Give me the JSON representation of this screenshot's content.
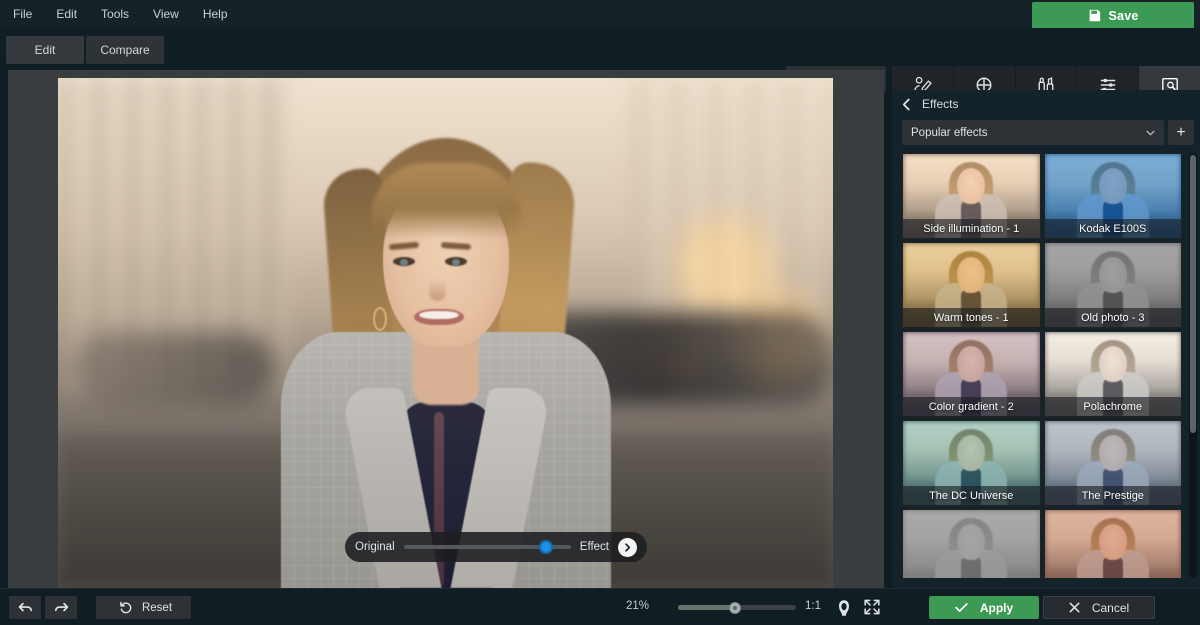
{
  "app": {
    "menu": [
      {
        "label": "File"
      },
      {
        "label": "Edit"
      },
      {
        "label": "Tools"
      },
      {
        "label": "View"
      },
      {
        "label": "Help"
      }
    ],
    "save_label": "Save",
    "save_icon": "floppy-disk-icon",
    "accent_green": "#3c9a55",
    "panel_bg": "#14222a",
    "canvas_bg": "#3a3d40"
  },
  "toolbar": {
    "mode_tabs": [
      {
        "label": "Edit",
        "active": true
      },
      {
        "label": "Compare",
        "active": false
      }
    ],
    "original_toggle": {
      "label": "Original",
      "icon": "eye-icon"
    }
  },
  "right_tabs": [
    {
      "label": "RETOUCH",
      "icon": "retouch-icon",
      "active": false
    },
    {
      "label": "SCULPT",
      "icon": "sculpt-icon",
      "active": false
    },
    {
      "label": "MAKEUP",
      "icon": "makeup-icon",
      "active": false
    },
    {
      "label": "COMMON",
      "icon": "sliders-icon",
      "active": false
    },
    {
      "label": "EFFECTS",
      "icon": "effects-icon",
      "active": true
    }
  ],
  "panel": {
    "back_icon": "chevron-left-icon",
    "title": "Effects",
    "preset": {
      "value": "Popular effects",
      "chevron": "chevron-down-icon"
    },
    "add_label": "+",
    "effects": [
      {
        "label": "Side illumination - 1",
        "tint": "rgba(255,215,180,0.30)"
      },
      {
        "label": "Kodak E100S",
        "tint": "rgba(35,120,200,0.52)"
      },
      {
        "label": "Warm tones - 1",
        "tint": "rgba(230,170,60,0.34)"
      },
      {
        "label": "Old photo - 3",
        "tint": "rgba(120,120,120,0.62)"
      },
      {
        "label": "Color gradient - 2",
        "tint": "rgba(150,120,170,0.30)"
      },
      {
        "label": "Polachrome",
        "tint": "rgba(215,205,190,0.28)"
      },
      {
        "label": "The DC Universe",
        "tint": "rgba(60,175,180,0.34)"
      },
      {
        "label": "The Prestige",
        "tint": "rgba(110,150,200,0.40)"
      },
      {
        "label": "",
        "tint": "rgba(140,140,140,0.72)"
      },
      {
        "label": "",
        "tint": "rgba(200,120,95,0.42)"
      }
    ]
  },
  "compare_slider": {
    "left_label": "Original",
    "right_label": "Effect",
    "value_percent": 85,
    "next_icon": "chevron-right-icon"
  },
  "bottombar": {
    "undo_icon": "undo-icon",
    "redo_icon": "redo-icon",
    "reset_icon": "reset-icon",
    "reset_label": "Reset",
    "zoom_percent": "21%",
    "zoom_slider_value": 48,
    "ratio_label": "1:1",
    "face_icon": "face-detect-icon",
    "fit_icon": "fit-to-screen-icon",
    "apply_label": "Apply",
    "apply_icon": "check-icon",
    "cancel_label": "Cancel",
    "cancel_icon": "close-icon"
  }
}
